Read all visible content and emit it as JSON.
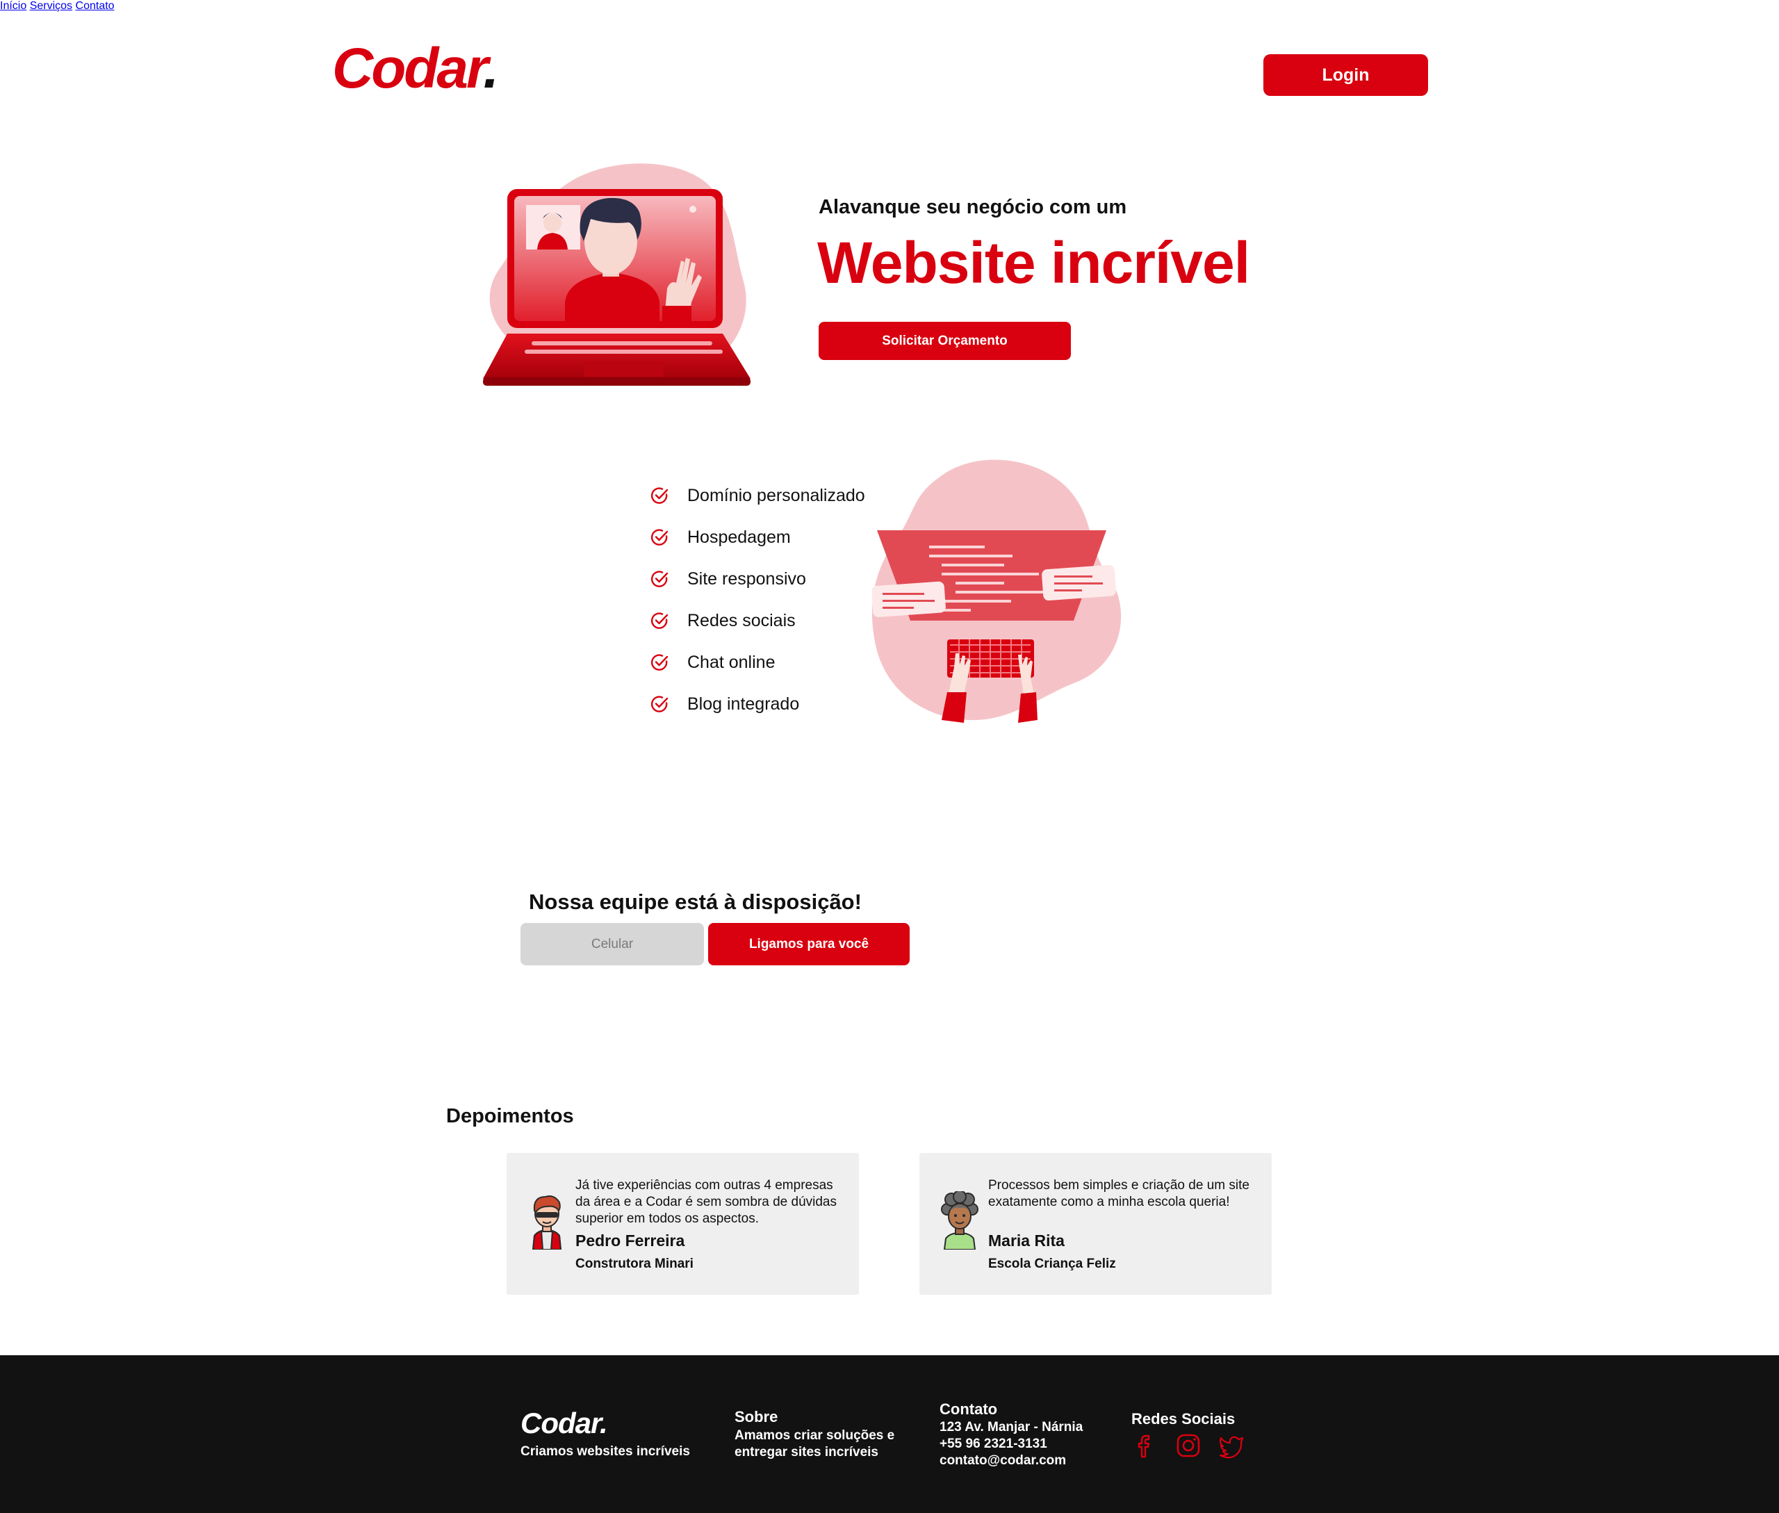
{
  "header": {
    "logo_text": "Codar",
    "logo_dot": ".",
    "nav": [
      "Início",
      "Serviços",
      "Contato"
    ],
    "login_label": "Login"
  },
  "hero": {
    "subtitle": "Alavanque seu negócio com um",
    "title": "Website incrível",
    "cta_label": "Solicitar Orçamento"
  },
  "features": {
    "items": [
      "Domínio personalizado",
      "Hospedagem",
      "Site responsivo",
      "Redes sociais",
      "Chat online",
      "Blog integrado"
    ]
  },
  "contact_cta": {
    "title": "Nossa equipe está à disposição!",
    "phone_placeholder": "Celular",
    "submit_label": "Ligamos para você"
  },
  "testimonials": {
    "title": "Depoimentos",
    "items": [
      {
        "quote": "Já tive experiências com outras 4 empresas da área e a Codar é sem sombra de dúvidas superior em todos os aspectos.",
        "name": "Pedro Ferreira",
        "company": "Construtora Minari",
        "avatar_icon": "man-sunglasses-avatar-icon"
      },
      {
        "quote": "Processos bem simples e criação de um site exatamente como a minha escola queria!",
        "name": "Maria Rita",
        "company": "Escola Criança Feliz",
        "avatar_icon": "woman-curly-hair-avatar-icon"
      }
    ]
  },
  "footer": {
    "logo_text": "Codar.",
    "tagline": "Criamos websites incríveis",
    "about": {
      "title": "Sobre",
      "lines": [
        "Amamos criar soluções e",
        "entregar sites incríveis"
      ]
    },
    "contact": {
      "title": "Contato",
      "lines": [
        "123 Av. Manjar - Nárnia",
        "+55 96 2321-3131",
        "contato@codar.com"
      ]
    },
    "social": {
      "title": "Redes Sociais",
      "icons": [
        "facebook-icon",
        "instagram-icon",
        "twitter-icon"
      ]
    }
  },
  "colors": {
    "brand_red": "#d9000f",
    "pink_blob": "#f5c3c7",
    "card_bg": "#efefef",
    "footer_bg": "#121212",
    "input_bg": "#d6d6d6"
  }
}
